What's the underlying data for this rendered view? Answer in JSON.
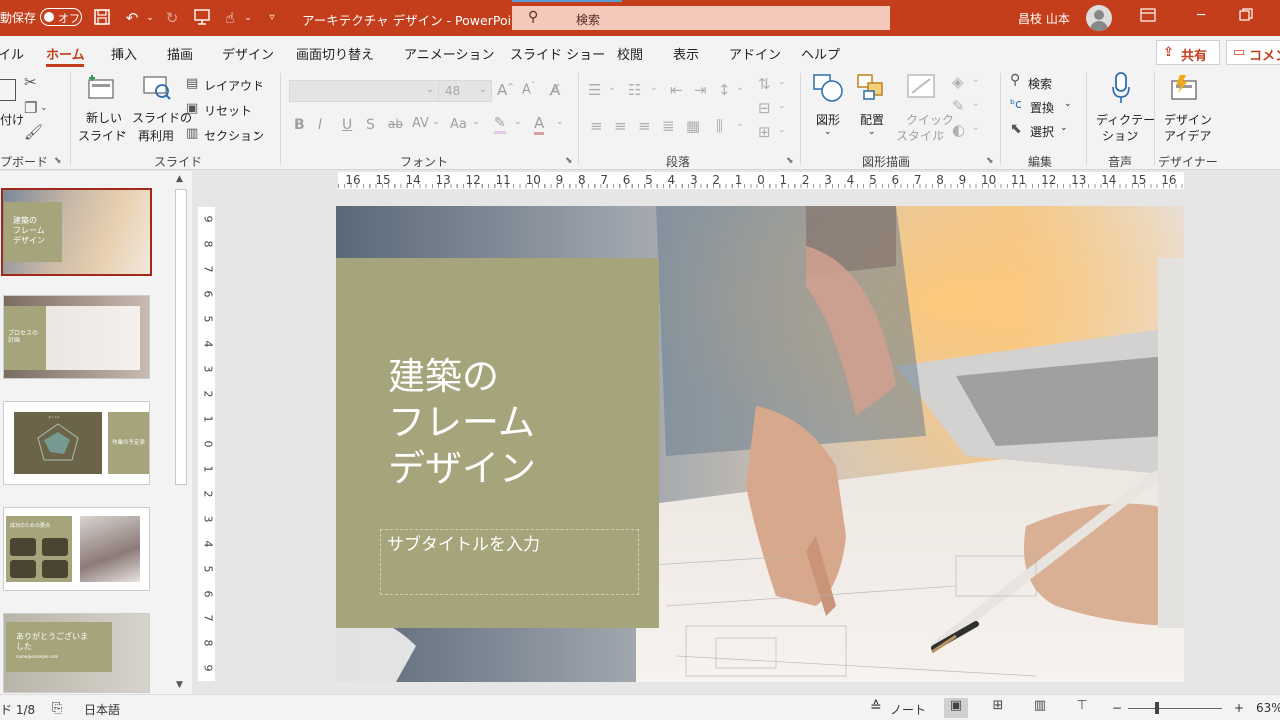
{
  "titlebar": {
    "autosave_label": "動保存",
    "toggle_label": "オフ",
    "doc_title": "アーキテクチャ デザイン  -  PowerPoint",
    "search_placeholder": "検索",
    "user_name": "昌枝 山本"
  },
  "tabs": [
    "イル",
    "ホーム",
    "挿入",
    "描画",
    "デザイン",
    "画面切り替え",
    "アニメーション",
    "スライド ショー",
    "校閲",
    "表示",
    "アドイン",
    "ヘルプ"
  ],
  "actions": {
    "share": "共有",
    "comment": "コメン"
  },
  "ribbon": {
    "clipboard": {
      "paste_partial": "付け",
      "group_label": "プボード"
    },
    "slides": {
      "new_slide_1": "新しい",
      "new_slide_2": "スライド",
      "reuse_1": "スライドの",
      "reuse_2": "再利用",
      "layout": "レイアウト",
      "reset": "リセット",
      "section": "セクション",
      "group_label": "スライド"
    },
    "font": {
      "size": "48",
      "group_label": "フォント"
    },
    "paragraph": {
      "group_label": "段落"
    },
    "drawing": {
      "shapes": "図形",
      "arrange": "配置",
      "quick_style_1": "クイック",
      "quick_style_2": "スタイル",
      "group_label": "図形描画"
    },
    "editing": {
      "find": "検索",
      "replace": "置換",
      "select": "選択",
      "group_label": "編集"
    },
    "voice": {
      "dictate_1": "ディクテー",
      "dictate_2": "ション",
      "group_label": "音声"
    },
    "designer": {
      "ideas_1": "デザイン",
      "ideas_2": "アイデア",
      "group_label": "デザイナー"
    }
  },
  "ruler": {
    "horizontal": [
      "16",
      "15",
      "14",
      "13",
      "12",
      "11",
      "10",
      "9",
      "8",
      "7",
      "6",
      "5",
      "4",
      "3",
      "2",
      "1",
      "0",
      "1",
      "2",
      "3",
      "4",
      "5",
      "6",
      "7",
      "8",
      "9",
      "10",
      "11",
      "12",
      "13",
      "14",
      "15",
      "16"
    ],
    "vertical": [
      "9",
      "8",
      "7",
      "6",
      "5",
      "4",
      "3",
      "2",
      "1",
      "0",
      "1",
      "2",
      "3",
      "4",
      "5",
      "6",
      "7",
      "8",
      "9"
    ]
  },
  "thumbnails": [
    {
      "title": "建築の\nフレーム\nデザイン"
    },
    {
      "title": "プロセスの\n計画"
    },
    {
      "title": "作業の予定表",
      "small": "タイトル"
    },
    {
      "title": "成功のための要点"
    },
    {
      "title": "ありがとうございま\nした",
      "small": "name@example.com"
    }
  ],
  "slide": {
    "title": "建築の\nフレーム\nデザイン",
    "subtitle": "サブタイトルを入力"
  },
  "status": {
    "slide_info": "ド 1/8",
    "language": "日本語",
    "notes": "ノート",
    "zoom_minus": "−",
    "zoom_plus": "+",
    "zoom_level": "63%"
  },
  "colors": {
    "accent": "#c43e1c",
    "olive": "#a5a47a"
  }
}
